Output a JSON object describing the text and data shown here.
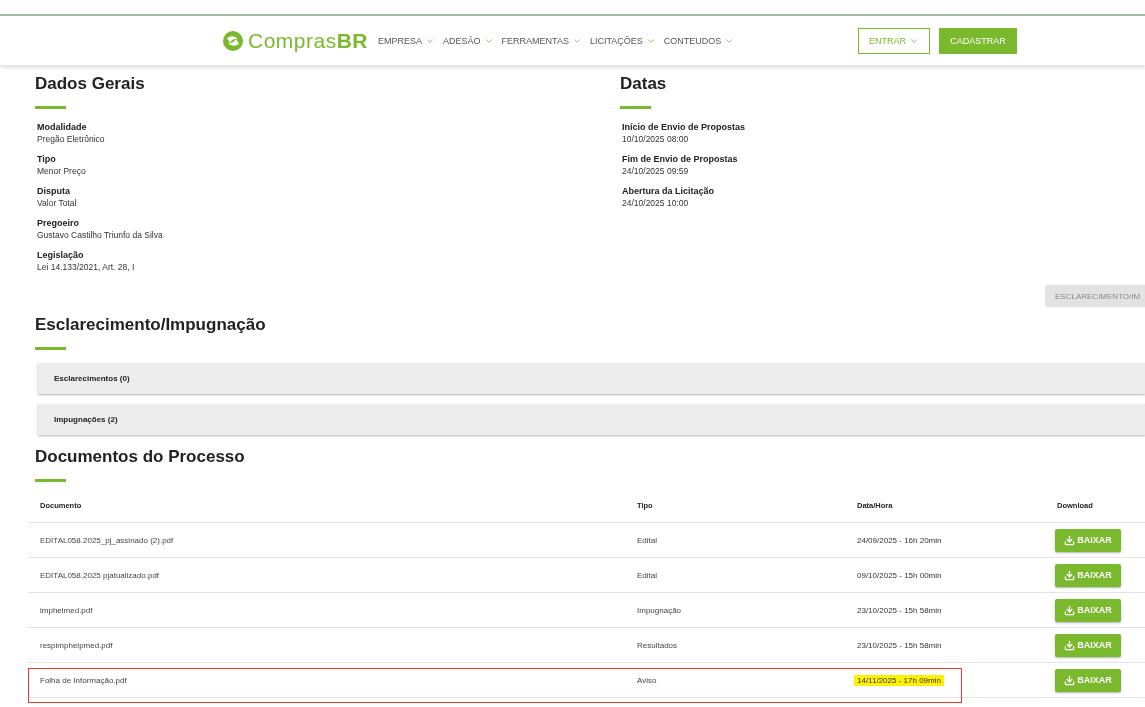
{
  "nav": {
    "logo": {
      "text": "Compras",
      "bold": "BR"
    },
    "menu": [
      {
        "label": "EMPRESA"
      },
      {
        "label": "ADESÃO"
      },
      {
        "label": "FERRAMENTAS"
      },
      {
        "label": "LICITAÇÕES"
      },
      {
        "label": "CONTEUDOS"
      }
    ],
    "login": "ENTRAR",
    "signup": "CADASTRAR"
  },
  "dados_gerais": {
    "title": "Dados Gerais",
    "fields": [
      {
        "label": "Modalidade",
        "value": "Pregão Eletrônico"
      },
      {
        "label": "Tipo",
        "value": "Menor Preço"
      },
      {
        "label": "Disputa",
        "value": "Valor Total"
      },
      {
        "label": "Pregoeiro",
        "value": "Gustavo Castilho Triunfo da Silva"
      },
      {
        "label": "Legislação",
        "value": "Lei 14.133/2021, Art. 28, I"
      }
    ]
  },
  "datas": {
    "title": "Datas",
    "fields": [
      {
        "label": "Início de Envio de Propostas",
        "value": "10/10/2025 08:00"
      },
      {
        "label": "Fim de Envio de Propostas",
        "value": "24/10/2025 09:59"
      },
      {
        "label": "Abertura da Licitação",
        "value": "24/10/2025 10:00"
      }
    ]
  },
  "esclarecimento_button": {
    "label": "ESCLARECIMENTO/IM",
    "disabled": true
  },
  "esclarecimento": {
    "title": "Esclarecimento/Impugnação",
    "panels": [
      {
        "label": "Esclarecimentos (0)"
      },
      {
        "label": "Impugnações (2)"
      }
    ]
  },
  "documentos": {
    "title": "Documentos do Processo",
    "columns": [
      "Documento",
      "Tipo",
      "Data/Hora",
      "Download"
    ],
    "rows": [
      {
        "documento": "EDITAL058.2025_pj_assinado (2).pdf",
        "tipo": "Edital",
        "data": "24/09/2025 - 16h 20min",
        "action": "BAIXAR",
        "highlighted": false
      },
      {
        "documento": "EDITAL058.2025 pjatualizado.pdf",
        "tipo": "Edital",
        "data": "09/10/2025 - 15h 00min",
        "action": "BAIXAR",
        "highlighted": false
      },
      {
        "documento": "imphelmed.pdf",
        "tipo": "Impugnação",
        "data": "23/10/2025 - 15h 58min",
        "action": "BAIXAR",
        "highlighted": false
      },
      {
        "documento": "respimphelpmed.pdf",
        "tipo": "Resultados",
        "data": "23/10/2025 - 15h 58min",
        "action": "BAIXAR",
        "highlighted": false
      },
      {
        "documento": "Folha de Informação.pdf",
        "tipo": "Aviso",
        "data": "14/11/2025 - 17h 09min",
        "action": "BAIXAR",
        "highlighted": true
      }
    ]
  }
}
